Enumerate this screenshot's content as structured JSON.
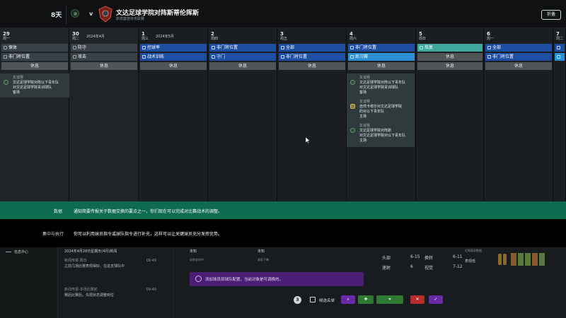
{
  "topbar": {
    "days": "8天",
    "vs": "v",
    "title": "文达足球学院对阵斯蒂伦挥斯",
    "subtitle": "斯宾塞普依克联赛",
    "fold_button": "折叠"
  },
  "calendar": {
    "days": [
      {
        "num": "29",
        "wk": "周一",
        "month": "",
        "sessions": [
          {
            "label": "保体",
            "style": "dark"
          },
          {
            "label": "非门将位置",
            "style": "dark"
          },
          {
            "label": "休息",
            "style": "rest"
          }
        ]
      },
      {
        "num": "30",
        "wk": "周二",
        "month": "2024年4月",
        "sessions": [
          {
            "label": "防守",
            "style": "dark"
          },
          {
            "label": "攻击",
            "style": "dark"
          },
          {
            "label": "休息",
            "style": "rest"
          }
        ]
      },
      {
        "num": "1",
        "wk": "周三",
        "month": "2024年5月",
        "sessions": [
          {
            "label": "控球率",
            "style": "blue"
          },
          {
            "label": "战术训练",
            "style": "blue"
          },
          {
            "label": "休息",
            "style": "rest"
          }
        ]
      },
      {
        "num": "2",
        "wk": "周四",
        "month": "",
        "sessions": [
          {
            "label": "非门将位置",
            "style": "blue"
          },
          {
            "label": "守门",
            "style": "blue"
          },
          {
            "label": "休息",
            "style": "rest"
          }
        ]
      },
      {
        "num": "3",
        "wk": "周五",
        "month": "",
        "sessions": [
          {
            "label": "全部",
            "style": "blue"
          },
          {
            "label": "非门将位置",
            "style": "blue"
          },
          {
            "label": "休息",
            "style": "rest"
          }
        ]
      },
      {
        "num": "4",
        "wk": "周六",
        "month": "",
        "sessions": [
          {
            "label": "非门将位置",
            "style": "blue"
          },
          {
            "label": "练习赛",
            "style": "lblue"
          },
          {
            "label": "休息",
            "style": "rest"
          }
        ]
      },
      {
        "num": "5",
        "wk": "周日",
        "month": "",
        "sessions": [
          {
            "label": "恢复",
            "style": "teal"
          },
          {
            "label": "休息",
            "style": "rest"
          },
          {
            "label": "休息",
            "style": "rest"
          }
        ]
      },
      {
        "num": "6",
        "wk": "周一",
        "month": "",
        "sessions": [
          {
            "label": "全部",
            "style": "blue"
          },
          {
            "label": "非门将位置",
            "style": "blue"
          },
          {
            "label": "休息",
            "style": "rest"
          }
        ]
      },
      {
        "num": "7",
        "wk": "周二",
        "month": "",
        "sessions": [
          {
            "label": "",
            "style": "blue"
          },
          {
            "label": "",
            "style": "lblue"
          }
        ]
      }
    ],
    "event_card_1": {
      "tag": "友谊赛",
      "line1": "文达足球学院对阵以下青年队",
      "line2": "对文达足球学院青训球队",
      "line3": "客场"
    },
    "event_card_2": [
      {
        "tag": "友谊赛",
        "line1": "文达足球学院对阵以下青年队",
        "line2": "对文达足球学院青训球队",
        "line3": "客场"
      },
      {
        "tag": "友谊赛",
        "line1": "自然卡塔尔对文达足球学院",
        "line2": "的对以下青年队",
        "line3": "主场"
      },
      {
        "tag": "友谊赛",
        "line1": "文达足球学院对阵斯",
        "line2": "对文达足球学院对以下青年队",
        "line3": "主场"
      }
    ]
  },
  "tips": {
    "tip1_label": "数据",
    "tip1_text": "通知简要传报关于数据交换的要点之一，你们现在可以完成对比赛战术的调整。",
    "tip2_label": "集中与执行",
    "tip2_text": "你可以利用球员指令或球队指令进行补充，这样可以让关键球员充分发挥优势。"
  },
  "bottom": {
    "nav_label": "信息中心",
    "news_date": "2024年4月28日星期天(4月)新闻",
    "news": [
      {
        "head": "新闻传报·周日",
        "time": "09:49",
        "body": "之前几场比赛表现得好，在这支球队中"
      },
      {
        "head": "新闻传报·本场比赛前",
        "time": "09:49",
        "body": "赛后比赛后，先把状态调整到位"
      }
    ],
    "info": {
      "a1": "未知",
      "a2": "未知",
      "b1": "训练安排中",
      "b2": "表现下降",
      "c1": "",
      "c2": ""
    },
    "warning": "添加球员到球队配置，当前对象是可调换的。",
    "stats": [
      {
        "k": "头部",
        "v": "6-15",
        "k2": "换转",
        "v2": "6-11"
      },
      {
        "k": "速射",
        "v": "6",
        "k2": "视觉",
        "v2": "7-12"
      }
    ],
    "perf_label": "近期表现数据",
    "perf_sub": "表现低",
    "actions": {
      "count": "3",
      "shortlist_label": "候选名单"
    }
  }
}
